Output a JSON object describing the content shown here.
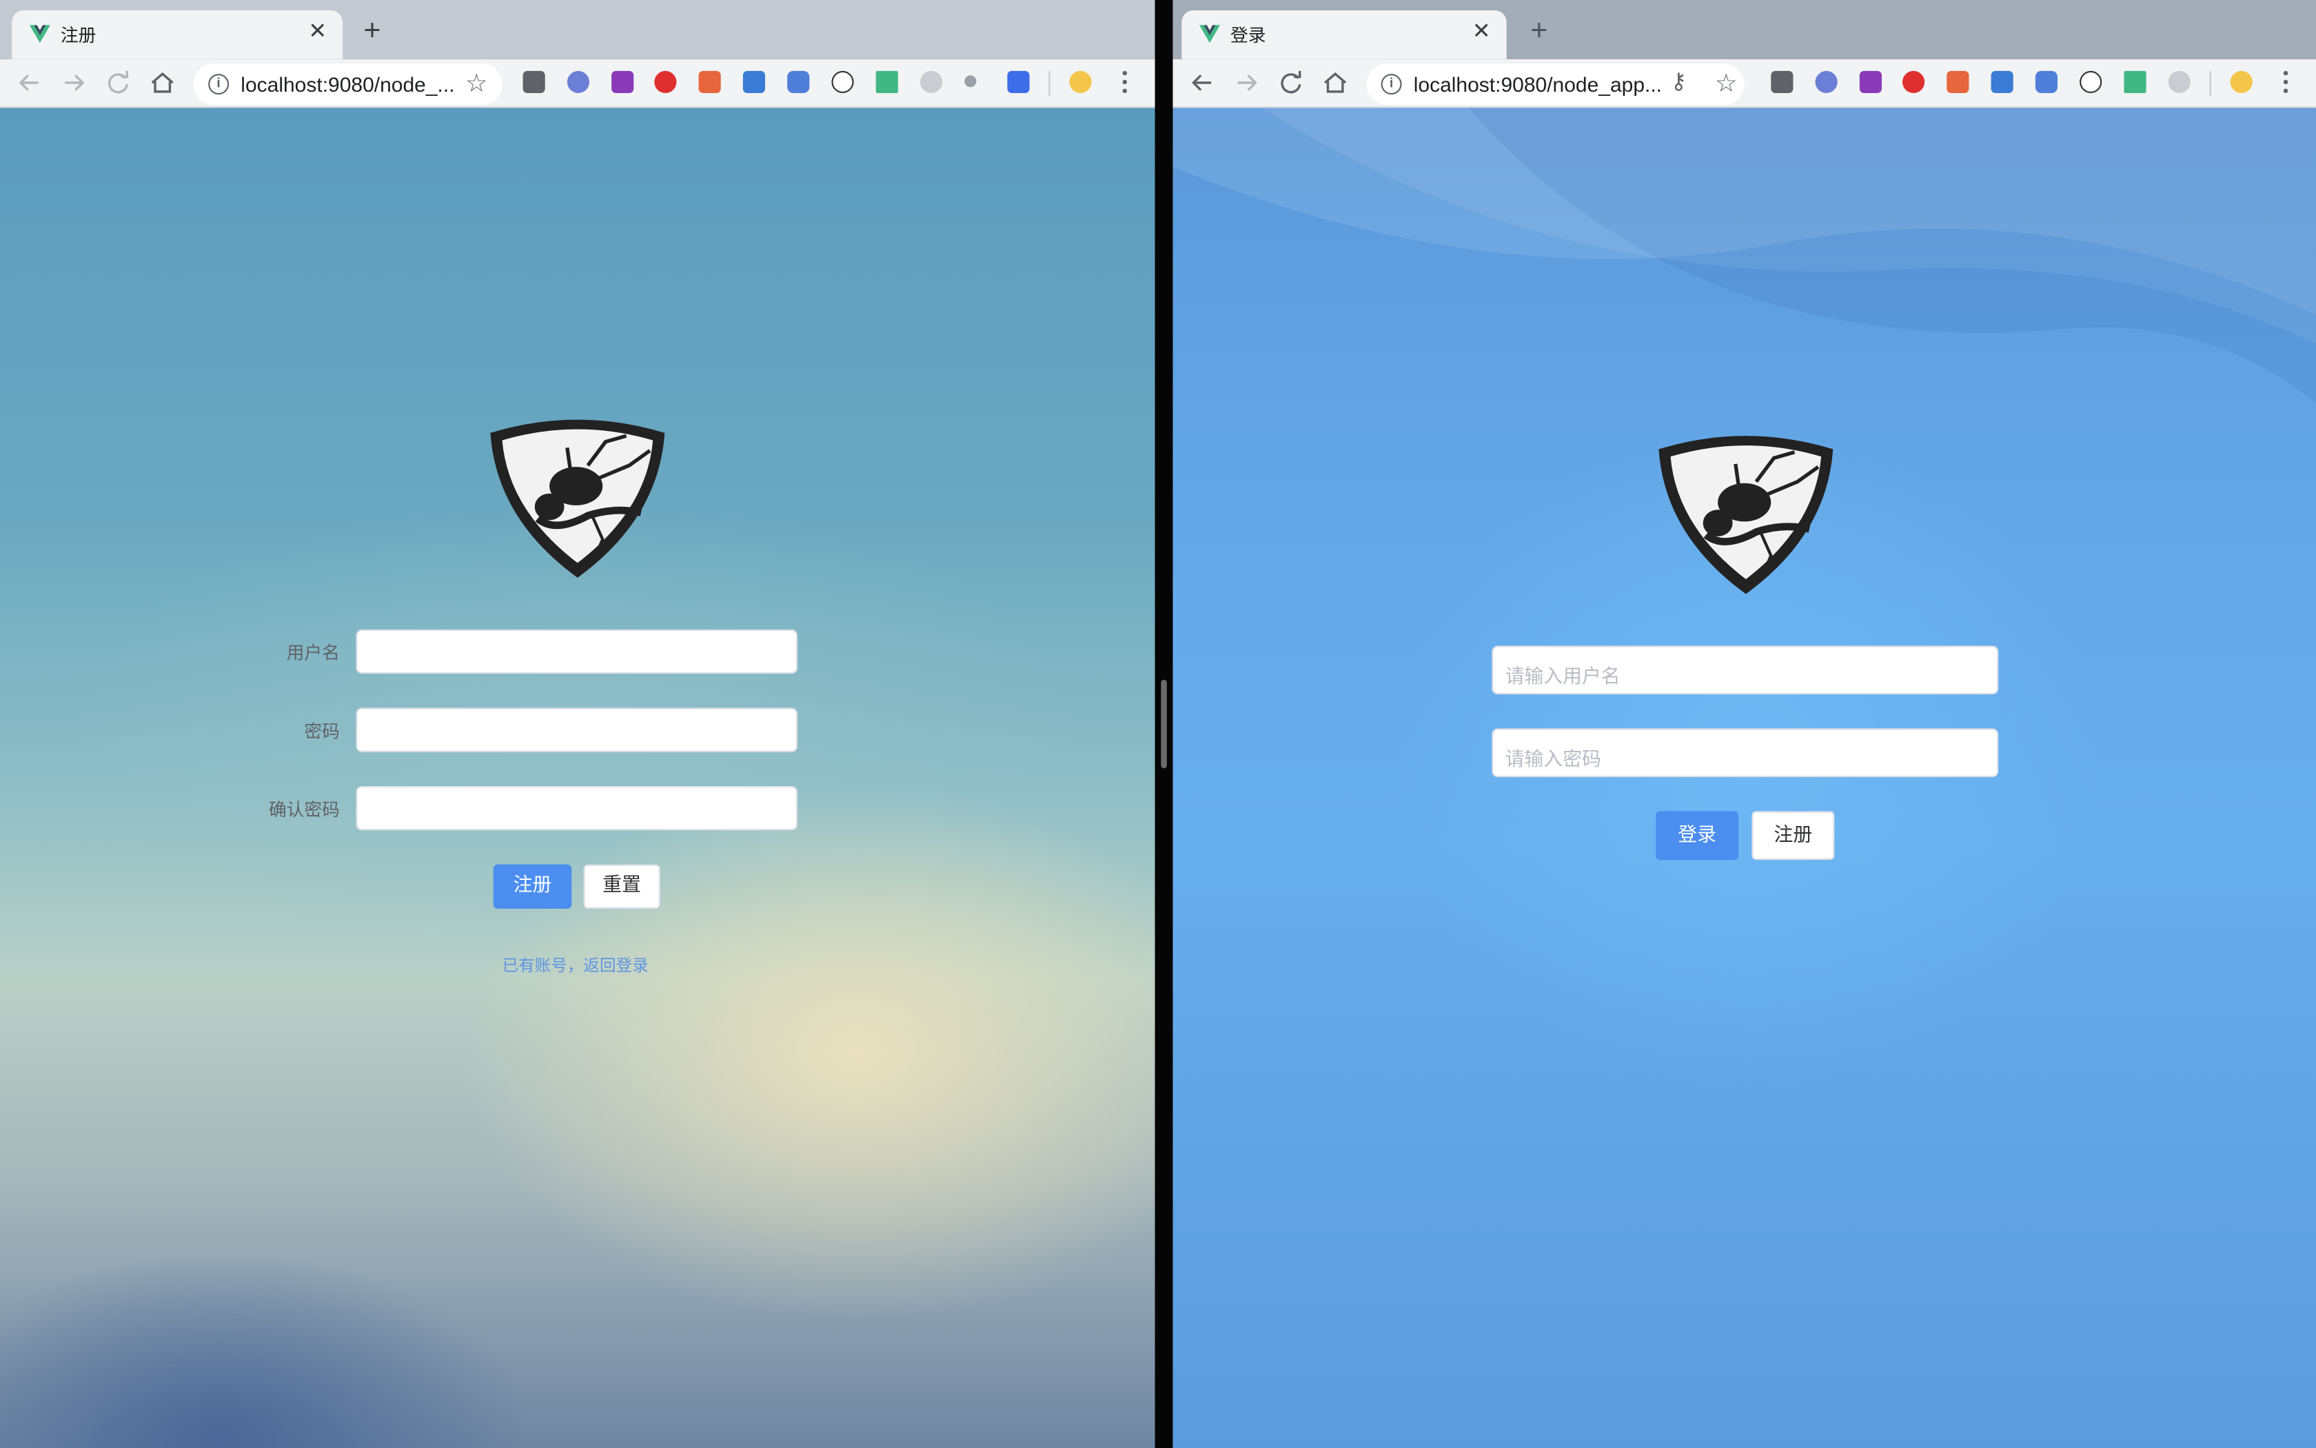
{
  "left": {
    "tab": {
      "title": "注册",
      "close": "✕"
    },
    "new_tab": "+",
    "url": "localhost:9080/node_...",
    "form": {
      "username_label": "用户名",
      "password_label": "密码",
      "confirm_label": "确认密码",
      "submit": "注册",
      "reset": "重置",
      "login_link": "已有账号，返回登录"
    }
  },
  "right": {
    "tab": {
      "title": "登录",
      "close": "✕"
    },
    "new_tab": "+",
    "url": "localhost:9080/node_app...",
    "form": {
      "username_placeholder": "请输入用户名",
      "password_placeholder": "请输入密码",
      "login": "登录",
      "register": "注册"
    }
  },
  "colors": {
    "primary": "#4b8ef0",
    "link": "#5d95e3"
  },
  "icons": {
    "tab": "vue-logo-icon",
    "back": "arrow-left-icon",
    "forward": "arrow-right-icon",
    "reload": "reload-icon",
    "home": "home-icon",
    "info": "info-icon",
    "star": "star-icon",
    "key": "key-icon",
    "menu": "more-vert-icon",
    "logo": "shield-ant-logo"
  }
}
